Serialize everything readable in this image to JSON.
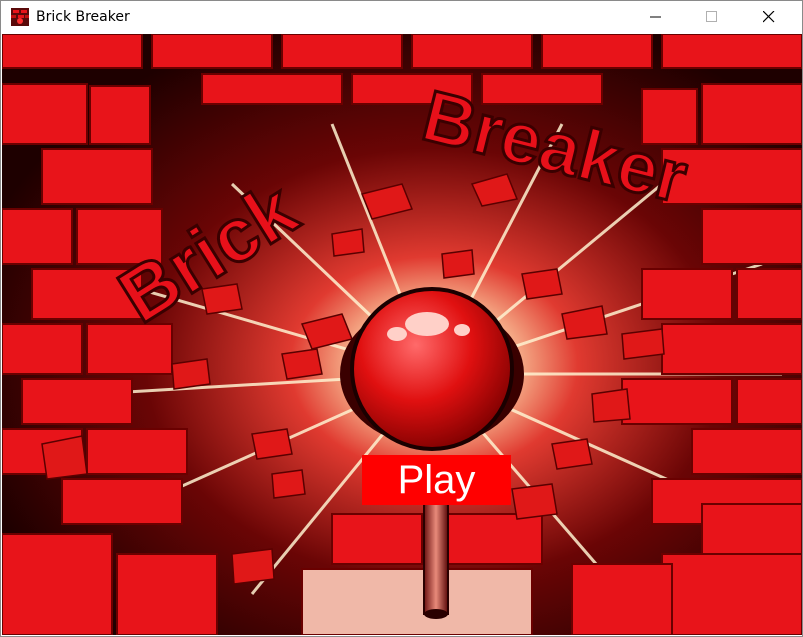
{
  "window": {
    "title": "Brick Breaker",
    "icon": "brick-breaker-app-icon",
    "controls": [
      "minimize-icon",
      "maximize-icon",
      "close-icon"
    ]
  },
  "game": {
    "title_art": "Brick Breaker",
    "play_label": "Play"
  },
  "colors": {
    "brick_red": "#e8141a",
    "play_button": "#ff0000",
    "background_dark": "#2a0000"
  }
}
